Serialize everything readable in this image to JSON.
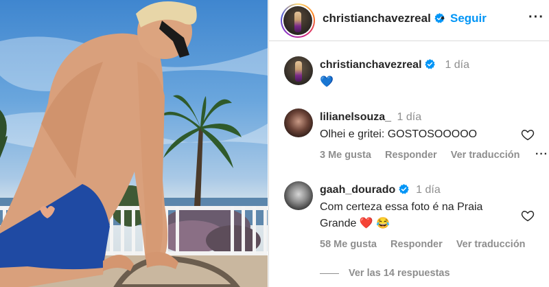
{
  "post": {
    "author": "christianchavezreal",
    "separator": "•",
    "follow_label": "Seguir",
    "more_icon": "···"
  },
  "caption": {
    "author": "christianchavezreal",
    "time": "1 día",
    "text": "💙"
  },
  "comments": [
    {
      "author": "lilianelsouza_",
      "time": "1 día",
      "text": "Olhei e gritei: GOSTOSOOOOO",
      "likes": "3 Me gusta",
      "reply": "Responder",
      "translate": "Ver traducción",
      "more_icon": "···"
    },
    {
      "author": "gaah_dourado",
      "time": "1 día",
      "text_line1": "Com certeza essa foto é na Praia",
      "text_line2": "Grande ❤️ 😂",
      "likes": "58 Me gusta",
      "reply": "Responder",
      "translate": "Ver traducción"
    }
  ],
  "view_replies": "Ver las 14 respuestas",
  "colors": {
    "verified": "#0095f6",
    "follow": "#0095f6",
    "muted": "#8e8e8e",
    "text": "#262626"
  }
}
